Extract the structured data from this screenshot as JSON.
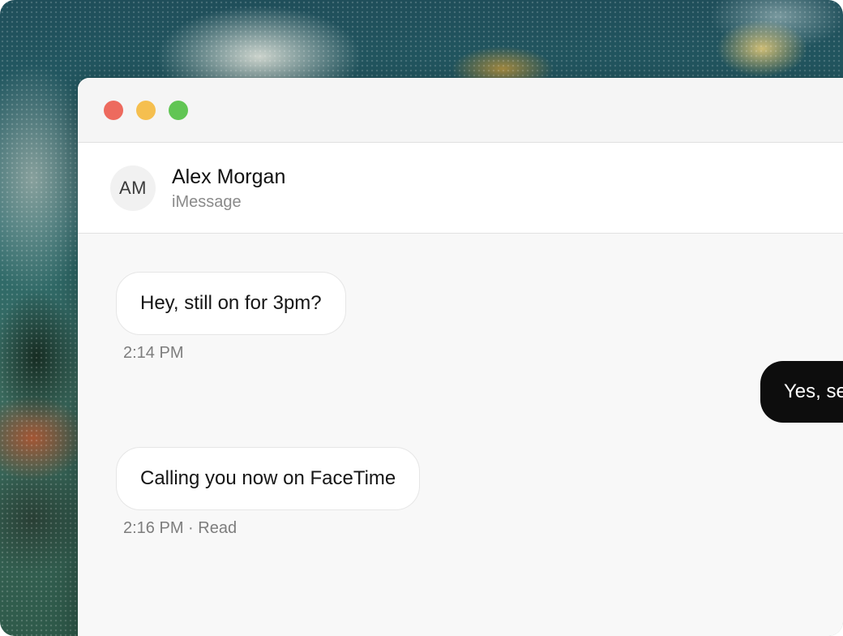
{
  "window": {
    "controls": {
      "close_color": "#ed6a5e",
      "minimize_color": "#f5bf4f",
      "zoom_color": "#61c554"
    }
  },
  "conversation": {
    "avatar_initials": "AM",
    "contact_name": "Alex Morgan",
    "service": "iMessage"
  },
  "messages": [
    {
      "direction": "incoming",
      "text": "Hey, still on for 3pm?",
      "meta": "2:14 PM"
    },
    {
      "direction": "outgoing",
      "text": "Yes, se"
    },
    {
      "direction": "incoming",
      "text": "Calling you now on FaceTime",
      "meta": "2:16 PM · Read"
    }
  ]
}
